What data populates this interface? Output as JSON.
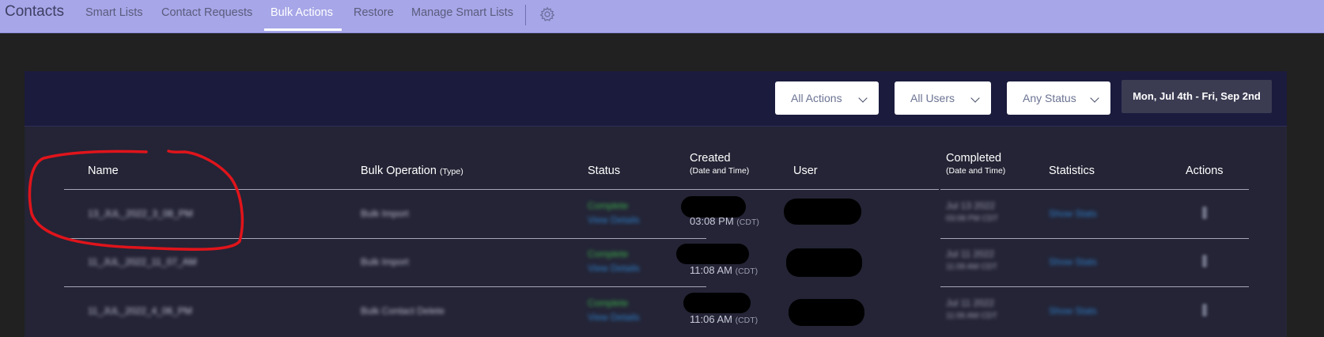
{
  "nav": {
    "title": "Contacts",
    "tabs": [
      {
        "label": "Smart Lists"
      },
      {
        "label": "Contact Requests"
      },
      {
        "label": "Bulk Actions"
      },
      {
        "label": "Restore"
      },
      {
        "label": "Manage Smart Lists"
      }
    ],
    "settings_icon": "gear-icon"
  },
  "filters": {
    "actions": "All Actions",
    "users": "All Users",
    "status": "Any Status",
    "date_range": "Mon, Jul 4th - Fri, Sep 2nd"
  },
  "table": {
    "columns": {
      "name": "Name",
      "operation": "Bulk Operation",
      "operation_sub": "(Type)",
      "status": "Status",
      "created": "Created",
      "created_sub": "(Date and Time)",
      "user": "User",
      "completed": "Completed",
      "completed_sub": "(Date and Time)",
      "statistics": "Statistics",
      "actions": "Actions"
    },
    "rows": [
      {
        "name": "13_JUL_2022_3_08_PM",
        "operation": "Bulk Import",
        "status": "Complete",
        "details_link": "View Details",
        "created_time": "03:08 PM",
        "created_tz": "(CDT)",
        "completed_date": "Jul 13 2022",
        "completed_time": "03:08 PM CDT",
        "stats_link": "Show Stats"
      },
      {
        "name": "11_JUL_2022_11_07_AM",
        "operation": "Bulk Import",
        "status": "Complete",
        "details_link": "View Details",
        "created_time": "11:08 AM",
        "created_tz": "(CDT)",
        "completed_date": "Jul 11 2022",
        "completed_time": "11:09 AM CDT",
        "stats_link": "Show Stats"
      },
      {
        "name": "11_JUL_2022_4_06_PM",
        "operation": "Bulk Contact Delete",
        "status": "Complete",
        "details_link": "View Details",
        "created_time": "11:06 AM",
        "created_tz": "(CDT)",
        "completed_date": "Jul 11 2022",
        "completed_time": "11:06 AM CDT",
        "stats_link": "Show Stats"
      }
    ]
  },
  "colors": {
    "nav_bg": "#a7a6e8",
    "page_bg": "#212121",
    "panel_header_bg": "#1b1b3e",
    "panel_bg": "#242436",
    "status_green": "#3bb04a",
    "link_blue": "#2d7fc8",
    "annotation_red": "#e0141b"
  }
}
